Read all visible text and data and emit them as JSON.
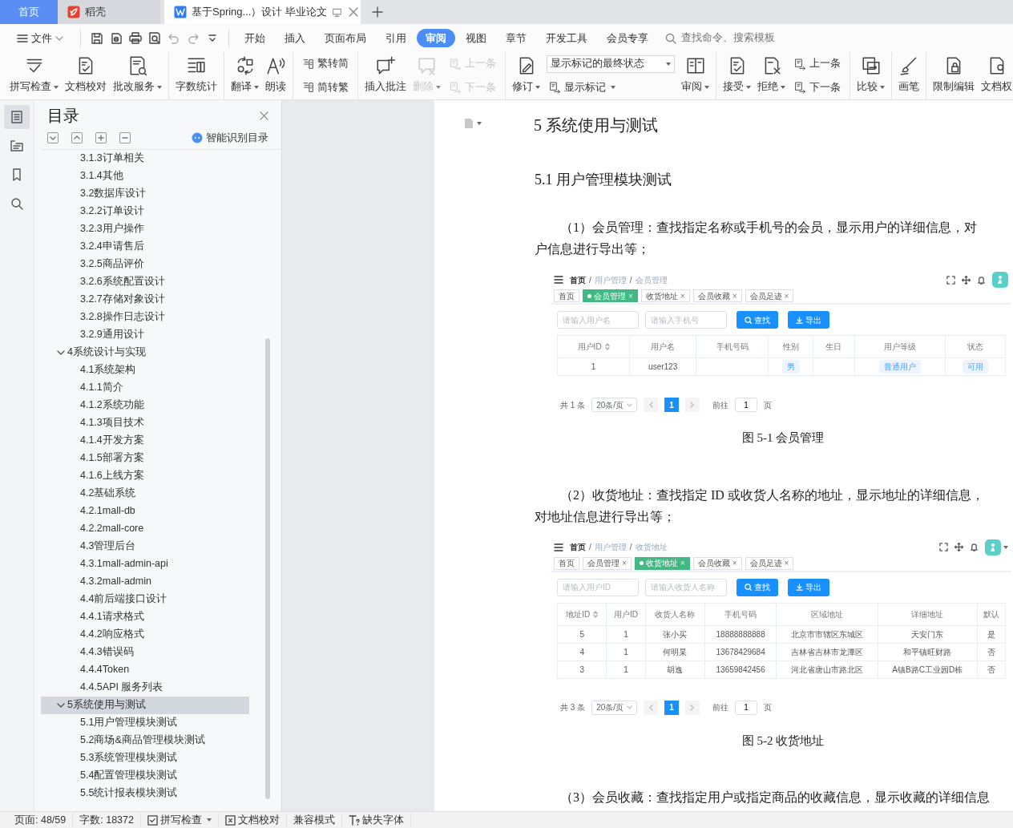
{
  "tabs": [
    {
      "label": "首页",
      "kind": "home",
      "selected": false
    },
    {
      "label": "稻壳",
      "kind": "app",
      "selected": false
    },
    {
      "label": "基于Spring...）设计 毕业论文",
      "kind": "doc",
      "selected": true
    }
  ],
  "menu": {
    "file": "文件",
    "tabs": [
      {
        "label": "开始",
        "selected": false
      },
      {
        "label": "插入",
        "selected": false
      },
      {
        "label": "页面布局",
        "selected": false
      },
      {
        "label": "引用",
        "selected": false
      },
      {
        "label": "审阅",
        "selected": true
      },
      {
        "label": "视图",
        "selected": false
      },
      {
        "label": "章节",
        "selected": false
      },
      {
        "label": "开发工具",
        "selected": false
      },
      {
        "label": "会员专享",
        "selected": false
      }
    ],
    "search": {
      "placeholder": "查找命令、搜索模板"
    }
  },
  "ribbon": [
    {
      "items": [
        {
          "kind": "large",
          "label": "拼写检查",
          "dropdown": true,
          "disabled": false
        },
        {
          "kind": "large",
          "label": "文档校对",
          "dropdown": false,
          "disabled": false
        },
        {
          "kind": "large",
          "label": "批改服务",
          "dropdown": true,
          "disabled": false
        }
      ]
    },
    {
      "items": [
        {
          "kind": "large",
          "label": "字数统计",
          "dropdown": false,
          "disabled": false
        }
      ]
    },
    {
      "items": [
        {
          "kind": "large",
          "label": "翻译",
          "dropdown": true,
          "disabled": false
        },
        {
          "kind": "large",
          "label": "朗读",
          "dropdown": false,
          "disabled": false
        }
      ]
    },
    {
      "items": [
        {
          "kind": "stack",
          "items": [
            {
              "kind": "small",
              "label": "繁转简",
              "dropdown": false,
              "disabled": false
            },
            {
              "kind": "small",
              "label": "简转繁",
              "dropdown": false,
              "disabled": false
            }
          ]
        }
      ]
    },
    {
      "items": [
        {
          "kind": "large",
          "label": "插入批注",
          "dropdown": false,
          "disabled": false
        },
        {
          "kind": "large",
          "label": "删除",
          "dropdown": true,
          "disabled": true
        },
        {
          "kind": "stack",
          "items": [
            {
              "kind": "small",
              "label": "上一条",
              "dropdown": false,
              "disabled": true
            },
            {
              "kind": "small",
              "label": "下一条",
              "dropdown": false,
              "disabled": true
            }
          ]
        }
      ]
    },
    {
      "items": [
        {
          "kind": "large",
          "label": "修订",
          "dropdown": true,
          "disabled": false
        },
        {
          "kind": "stack",
          "items": [
            {
              "kind": "select",
              "label": "显示标记的最终状态",
              "dropdown": true,
              "disabled": false
            },
            {
              "kind": "small",
              "label": "显示标记",
              "dropdown": true,
              "disabled": false
            }
          ]
        },
        {
          "kind": "large",
          "label": "审阅",
          "dropdown": true,
          "disabled": false
        }
      ]
    },
    {
      "items": [
        {
          "kind": "large",
          "label": "接受",
          "dropdown": true,
          "disabled": false
        },
        {
          "kind": "large",
          "label": "拒绝",
          "dropdown": true,
          "disabled": false
        },
        {
          "kind": "stack",
          "items": [
            {
              "kind": "small",
              "label": "上一条",
              "dropdown": false,
              "disabled": false
            },
            {
              "kind": "small",
              "label": "下一条",
              "dropdown": false,
              "disabled": false
            }
          ]
        }
      ]
    },
    {
      "items": [
        {
          "kind": "large",
          "label": "比较",
          "dropdown": true,
          "disabled": false
        }
      ]
    },
    {
      "items": [
        {
          "kind": "large",
          "label": "画笔",
          "dropdown": false,
          "disabled": false
        }
      ]
    },
    {
      "items": [
        {
          "kind": "large",
          "label": "限制编辑",
          "dropdown": false,
          "disabled": false
        },
        {
          "kind": "large",
          "label": "文档权",
          "dropdown": false,
          "disabled": false
        }
      ]
    }
  ],
  "rail": [
    {
      "selected": true
    },
    {
      "selected": false
    },
    {
      "selected": false
    },
    {
      "selected": false
    }
  ],
  "toc": {
    "title": "目录",
    "smart": "智能识别目录",
    "continued_items": [
      {
        "label": "3.1.3订单相关"
      },
      {
        "label": "3.1.4其他"
      },
      {
        "label": "3.2数据库设计"
      },
      {
        "label": "3.2.2订单设计"
      },
      {
        "label": "3.2.3用户操作"
      },
      {
        "label": "3.2.4申请售后"
      },
      {
        "label": "3.2.5商品评价"
      },
      {
        "label": "3.2.6系统配置设计"
      },
      {
        "label": "3.2.7存储对象设计"
      },
      {
        "label": "3.2.8操作日志设计"
      },
      {
        "label": "3.2.9通用设计"
      }
    ],
    "items": [
      {
        "label": "4系统设计与实现",
        "expanded": true,
        "selected": false,
        "children": [
          {
            "label": "4.1系统架构"
          },
          {
            "label": "4.1.1简介"
          },
          {
            "label": "4.1.2系统功能"
          },
          {
            "label": "4.1.3项目技术"
          },
          {
            "label": "4.1.4开发方案"
          },
          {
            "label": "4.1.5部署方案"
          },
          {
            "label": "4.1.6上线方案"
          },
          {
            "label": "4.2基础系统"
          },
          {
            "label": "4.2.1mall-db"
          },
          {
            "label": "4.2.2mall-core"
          },
          {
            "label": "4.3管理后台"
          },
          {
            "label": "4.3.1mall-admin-api"
          },
          {
            "label": "4.3.2mall-admin"
          },
          {
            "label": "4.4前后端接口设计"
          },
          {
            "label": "4.4.1请求格式"
          },
          {
            "label": "4.4.2响应格式"
          },
          {
            "label": "4.4.3错误码"
          },
          {
            "label": "4.4.4Token"
          },
          {
            "label": "4.4.5API 服务列表"
          }
        ]
      },
      {
        "label": "5系统使用与测试",
        "expanded": true,
        "selected": true,
        "children": [
          {
            "label": "5.1用户管理模块测试"
          },
          {
            "label": "5.2商场&商品管理模块测试"
          },
          {
            "label": "5.3系统管理模块测试"
          },
          {
            "label": "5.4配置管理模块测试"
          },
          {
            "label": "5.5统计报表模块测试"
          }
        ]
      }
    ]
  },
  "document": [
    {
      "kind": "heading",
      "text": "5 系统使用与测试"
    },
    {
      "kind": "subheading",
      "text": "5.1 用户管理模块测试"
    },
    {
      "kind": "paragraph",
      "lines": [
        "（1）会员管理：查找指定名称或手机号的会员，显示用户的详细信息，对",
        "户信息进行导出等；"
      ]
    },
    {
      "kind": "figure",
      "separator": "/",
      "breadcrumb": [
        "首页",
        "用户管理",
        "会员管理"
      ],
      "close_mark": "×",
      "tags": [
        {
          "label": "首页",
          "selected": false,
          "closable": false
        },
        {
          "label": "会员管理",
          "selected": true,
          "closable": true
        },
        {
          "label": "收货地址",
          "selected": false,
          "closable": true
        },
        {
          "label": "会员收藏",
          "selected": false,
          "closable": true
        },
        {
          "label": "会员足迹",
          "selected": false,
          "closable": true
        }
      ],
      "fields": [
        {
          "placeholder": "请输入用户名"
        },
        {
          "placeholder": "请输入手机号"
        }
      ],
      "buttons": [
        {
          "label": "查找",
          "kind": "search"
        },
        {
          "label": "导出",
          "kind": "export"
        }
      ],
      "columns": [
        {
          "label": "用户ID",
          "sortable": true,
          "tag": false
        },
        {
          "label": "用户名",
          "sortable": false,
          "tag": false
        },
        {
          "label": "手机号码",
          "sortable": false
        },
        {
          "label": "性别",
          "sortable": false,
          "tag": true
        },
        {
          "label": "生日",
          "sortable": false
        },
        {
          "label": "用户等级",
          "sortable": false,
          "tag": true
        },
        {
          "label": "状态",
          "sortable": false,
          "tag": true
        }
      ],
      "rows": [
        [
          "1",
          "user123",
          null,
          "男",
          null,
          "普通用户",
          "可用"
        ]
      ],
      "pager": {
        "total": "共 1 条",
        "size": "20条/页",
        "page": "1",
        "goto": "前往",
        "goto_value": "1",
        "unit": "页"
      }
    },
    {
      "kind": "caption",
      "text": "图 5-1 会员管理"
    },
    {
      "kind": "paragraph",
      "lines": [
        "（2）收货地址：查找指定 ID 或收货人名称的地址，显示地址的详细信息，",
        "对地址信息进行导出等；"
      ]
    },
    {
      "kind": "figure",
      "separator": "/",
      "breadcrumb": [
        "首页",
        "用户管理",
        "收货地址"
      ],
      "menu_caret": true,
      "close_mark": "×",
      "tags": [
        {
          "label": "首页",
          "selected": false,
          "closable": false
        },
        {
          "label": "会员管理",
          "selected": false,
          "closable": true
        },
        {
          "label": "收货地址",
          "selected": true,
          "closable": true
        },
        {
          "label": "会员收藏",
          "selected": false,
          "closable": true
        },
        {
          "label": "会员足迹",
          "selected": false,
          "closable": true
        }
      ],
      "fields": [
        {
          "placeholder": "请输入用户ID"
        },
        {
          "placeholder": "请输入收货人名称"
        }
      ],
      "buttons": [
        {
          "label": "查找",
          "kind": "search"
        },
        {
          "label": "导出",
          "kind": "export"
        }
      ],
      "columns": [
        {
          "label": "地址ID",
          "sortable": true,
          "tag": false
        },
        {
          "label": "用户ID",
          "sortable": false,
          "tag": false
        },
        {
          "label": "收货人名称",
          "sortable": false,
          "tag": false
        },
        {
          "label": "手机号码",
          "sortable": false,
          "tag": false
        },
        {
          "label": "区域地址",
          "sortable": false,
          "tag": false
        },
        {
          "label": "详细地址",
          "sortable": false,
          "tag": false
        },
        {
          "label": "默认",
          "sortable": false,
          "tag": false
        }
      ],
      "rows": [
        [
          "5",
          "1",
          "张小买",
          "18888888888",
          "北京市市辖区东城区",
          "天安门东",
          "是"
        ],
        [
          "4",
          "1",
          "何明杲",
          "13678429684",
          "吉林省吉林市龙潭区",
          "和平镇旺财路",
          "否"
        ],
        [
          "3",
          "1",
          "胡逸",
          "13659842456",
          "河北省唐山市路北区",
          "A镇B路C工业园D栋",
          "否"
        ]
      ],
      "pager": {
        "total": "共 3 条",
        "size": "20条/页",
        "page": "1",
        "goto": "前往",
        "goto_value": "1",
        "unit": "页"
      }
    },
    {
      "kind": "caption",
      "text": "图 5-2 收货地址"
    },
    {
      "kind": "paragraph",
      "lines": [
        "（3）会员收藏：查找指定用户或指定商品的收藏信息，显示收藏的详细信息"
      ]
    }
  ],
  "status_bar": [
    {
      "label": "页面: 48/59",
      "kind": "text",
      "dropdown": false
    },
    {
      "label": "字数: 18372",
      "kind": "text",
      "dropdown": false
    },
    {
      "label": "拼写检查",
      "kind": "check",
      "dropdown": true
    },
    {
      "label": "文档校对",
      "kind": "proof",
      "dropdown": false
    },
    {
      "label": "兼容模式",
      "kind": "text",
      "dropdown": false
    },
    {
      "label": "缺失字体",
      "kind": "font",
      "dropdown": false
    }
  ]
}
